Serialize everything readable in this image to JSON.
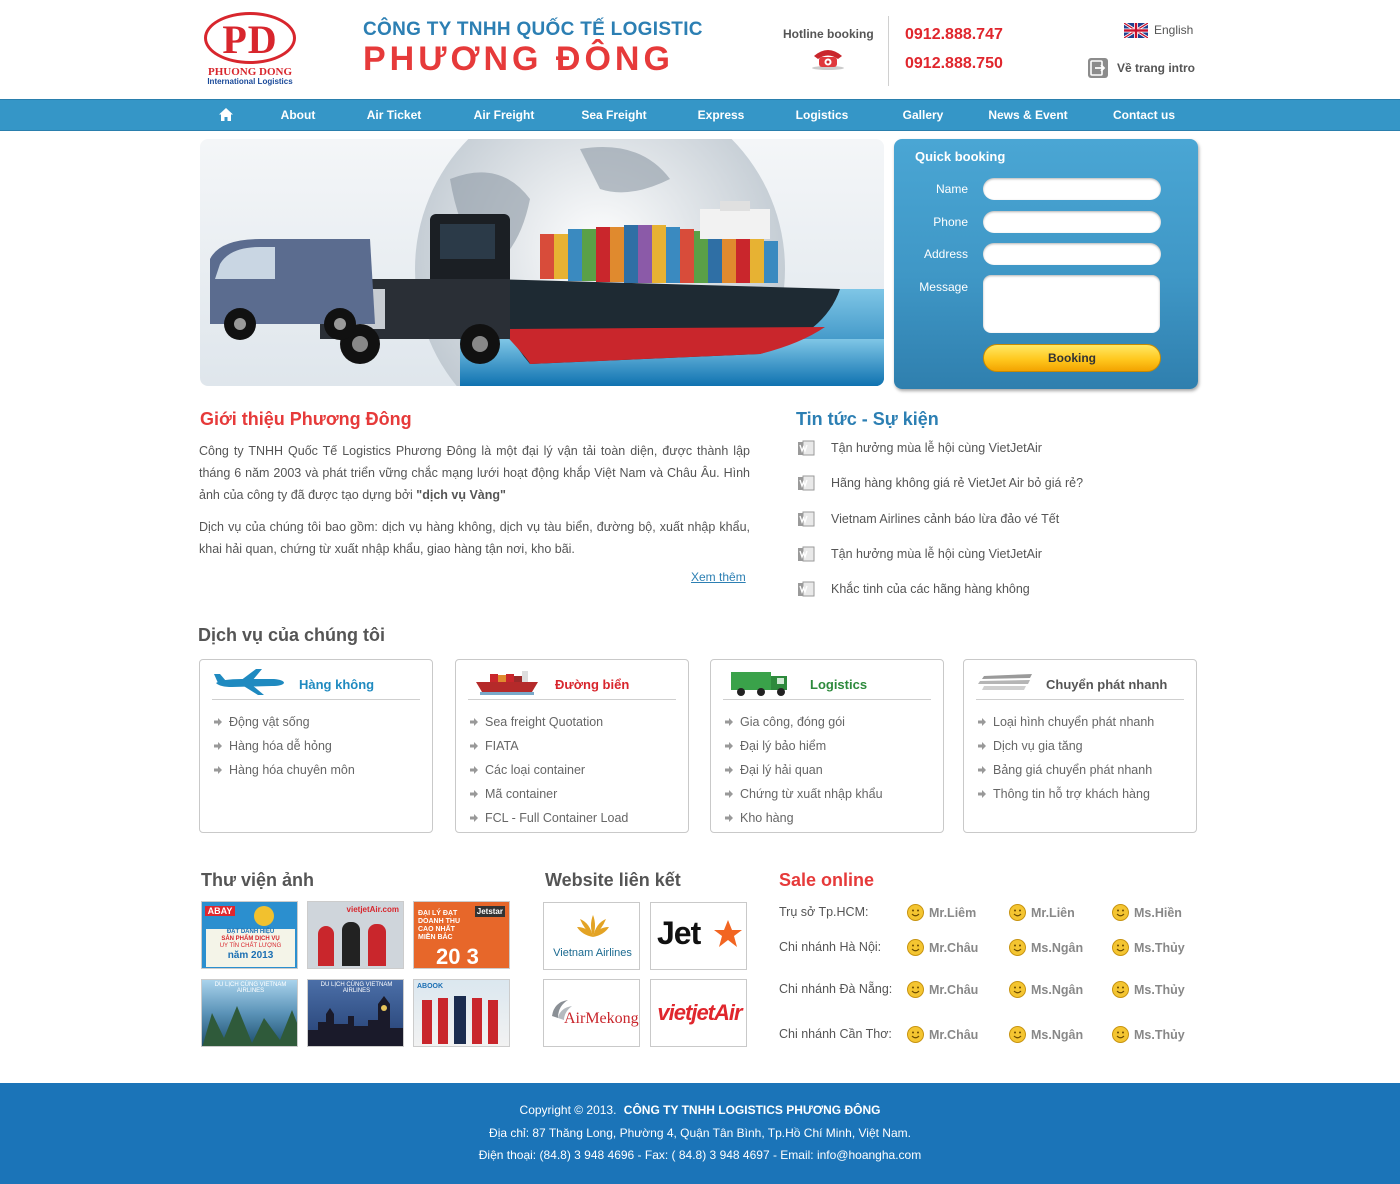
{
  "header": {
    "logo_text": "PD",
    "logo_line1": "PHUONG DONG",
    "logo_line2": "International Logistics",
    "company_line1": "CÔNG TY TNHH QUỐC TẾ LOGISTIC",
    "company_line2": "PHƯƠNG ĐÔNG",
    "hotline_label": "Hotline booking",
    "hotline_1": "0912.888.747",
    "hotline_2": "0912.888.750",
    "language": "English",
    "intro_link": "Về trang intro"
  },
  "nav": {
    "items": [
      "About",
      "Air Ticket",
      "Air Freight",
      "Sea Freight",
      "Express",
      "Logistics",
      "Gallery",
      "News & Event",
      "Contact us"
    ]
  },
  "booking": {
    "title": "Quick booking",
    "name_label": "Name",
    "phone_label": "Phone",
    "address_label": "Address",
    "message_label": "Message",
    "button_label": "Booking"
  },
  "intro": {
    "title": "Giới thiệu Phương Đông",
    "para1_text": "Công ty TNHH Quốc Tế Logistics Phương Đông là một đại lý vận tải toàn diện, được thành lập tháng 6 năm 2003 và phát triển vững chắc mạng lưới hoạt động khắp Việt Nam và Châu Âu. Hình ảnh của công ty đã được tạo dựng bởi ",
    "para1_bold": "\"dịch vụ Vàng\"",
    "para2": "Dịch vụ của chúng tôi bao gồm: dịch vụ hàng không, dịch vụ tàu biển, đường bộ, xuất nhập khẩu, khai hải quan, chứng từ xuất nhập khẩu, giao hàng tận nơi, kho bãi.",
    "more_link": "Xem thêm"
  },
  "news": {
    "title": "Tin tức - Sự kiện",
    "items": [
      "Tận hưởng mùa lễ hội cùng VietJetAir",
      "Hãng hàng không giá rẻ VietJet Air bỏ giá rẻ?",
      "Vietnam Airlines cảnh báo lừa đảo vé Tết",
      "Tận hưởng mùa lễ hội cùng VietJetAir",
      "Khắc tinh của các hãng hàng không"
    ]
  },
  "services": {
    "title": "Dịch vụ của chúng tôi",
    "boxes": [
      {
        "title": "Hàng không",
        "items": [
          "Động vật sống",
          "Hàng hóa dễ hỏng",
          "Hàng hóa chuyên môn"
        ]
      },
      {
        "title": "Đường biển",
        "items": [
          "Sea freight Quotation",
          "FIATA",
          "Các loại container",
          "Mã container",
          "FCL - Full Container Load"
        ]
      },
      {
        "title": "Logistics",
        "items": [
          "Gia công, đóng gói",
          "Đại lý bảo hiểm",
          "Đại lý hải quan",
          "Chứng từ xuất nhập khẩu",
          "Kho hàng"
        ]
      },
      {
        "title": "Chuyển phát nhanh",
        "items": [
          "Loại hình chuyển phát nhanh",
          "Dịch vụ gia tăng",
          "Bảng giá chuyển phát nhanh",
          "Thông tin hỗ trợ khách hàng"
        ]
      }
    ]
  },
  "gallery": {
    "title": "Thư viện ảnh",
    "thumb1_lines": [
      "ABAY",
      "ĐẠT DANH HIỆU",
      "SẢN PHẨM DỊCH VỤ",
      "UY TÍN CHẤT LƯỢNG",
      "năm 2013"
    ],
    "thumb2_text": "vietjetAir.com",
    "thumb3_lines": [
      "ĐẠI LÝ ĐẠT",
      "DOANH THU",
      "CAO NHẤT",
      "MIỀN BẮC",
      "20 3"
    ],
    "thumb3_brand": "Jetstar",
    "thumb4_text": "DU LỊCH CÙNG VIETNAM AIRLINES",
    "thumb5_text": "DU LỊCH CÙNG VIETNAM AIRLINES",
    "thumb6_text": "ABOOK"
  },
  "links": {
    "title": "Website liên kết",
    "vna": "Vietnam Airlines",
    "jetstar": "Jet",
    "mekong": "AirMekong",
    "vietjet": "vietjetAir"
  },
  "sale": {
    "title": "Sale online",
    "rows": [
      {
        "label": "Trụ sở Tp.HCM:",
        "people": [
          "Mr.Liêm",
          "Mr.Liên",
          "Ms.Hiền"
        ]
      },
      {
        "label": "Chi nhánh Hà Nội:",
        "people": [
          "Mr.Châu",
          "Ms.Ngân",
          "Ms.Thủy"
        ]
      },
      {
        "label": "Chi nhánh Đà Nẵng:",
        "people": [
          "Mr.Châu",
          "Ms.Ngân",
          "Ms.Thủy"
        ]
      },
      {
        "label": "Chi nhánh Cần Thơ:",
        "people": [
          "Mr.Châu",
          "Ms.Ngân",
          "Ms.Thủy"
        ]
      }
    ]
  },
  "footer": {
    "copyright": "Copyright © 2013.",
    "company": "CÔNG TY TNHH LOGISTICS PHƯƠNG ĐÔNG",
    "address": "Địa chỉ: 87 Thăng Long, Phường 4, Quận Tân Bình, Tp.Hồ Chí Minh, Việt Nam.",
    "contact": "Điện thoại: (84.8) 3 948 4696 - Fax: ( 84.8) 3 948 4697 - Email: info@hoangha.com"
  },
  "colors": {
    "nav_bg": "#3596c7",
    "brand_red": "#e63a3a",
    "brand_blue": "#2c7fb3",
    "footer_bg": "#1b74b8"
  }
}
